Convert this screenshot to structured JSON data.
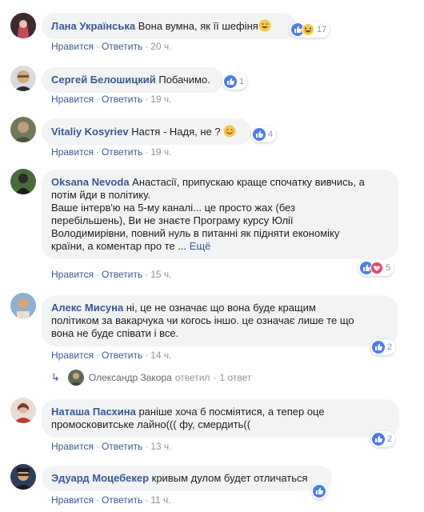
{
  "like_label": "Нравится",
  "reply_label": "Ответить",
  "separator": "·",
  "more_label": "Ещё",
  "comments": [
    {
      "author": "Лана Українська",
      "text": "Вона вумна, як її шефіня",
      "time": "20 ч.",
      "reactions": {
        "icons": [
          "like-icon",
          "haha-icon"
        ],
        "count": "17"
      }
    },
    {
      "author": "Сергей Белошицкий",
      "text": "Побачимо.",
      "time": "19 ч.",
      "reactions": {
        "icons": [
          "like-icon"
        ],
        "count": "1"
      }
    },
    {
      "author": "Vitaliy Kosyriev",
      "text": "Настя - Надя, не ?",
      "time": "19 ч.",
      "reactions": {
        "icons": [
          "like-icon"
        ],
        "count": "4"
      }
    },
    {
      "author": "Oksana Nevoda",
      "text": "Анастасії, припускаю краще спочатку вивчись, а\nпотім йди в політику.\nВаше інтерв'ю на 5-му каналі... це просто жах (без\nперебільшень), Ви не знаєте Програму курсу Юлії\nВолодимирівни, повний нуль в питанні як підняти економіку\nкраїни, а коментар про те ...",
      "time": "15 ч.",
      "reactions": {
        "icons": [
          "like-icon",
          "love-icon"
        ],
        "count": "5"
      }
    },
    {
      "author": "Алекс Мисуна",
      "text": "ні, це не означає що вона буде кращим\nполітиком за вакарчука чи когось іншо. це означає лише те що\nвона не буде співати і все.",
      "time": "14 ч.",
      "reactions": {
        "icons": [
          "like-icon"
        ],
        "count": "2"
      }
    },
    {
      "author": "Наташа Пасхина",
      "text": "раніше хоча б посміятися, а тепер оце\nпромосковитське лайно((( фу, смердить((",
      "time": "13 ч.",
      "reactions": {
        "icons": [
          "like-icon"
        ],
        "count": "2"
      }
    },
    {
      "author": "Эдуард Моцебекер",
      "text": "кривым дулом будет отличаться",
      "time": "11 ч.",
      "reactions": {
        "icons": [
          "like-icon"
        ],
        "count": ""
      }
    }
  ],
  "reply_thread": {
    "author": "Олександр Закора",
    "action": "ответил",
    "count": "1 ответ"
  },
  "colors": {
    "link": "#385898",
    "bubble": "#f2f3f5",
    "meta": "#90949c",
    "like": "#4a7ef0",
    "love": "#f0425f",
    "emoji": "#f7c948"
  }
}
